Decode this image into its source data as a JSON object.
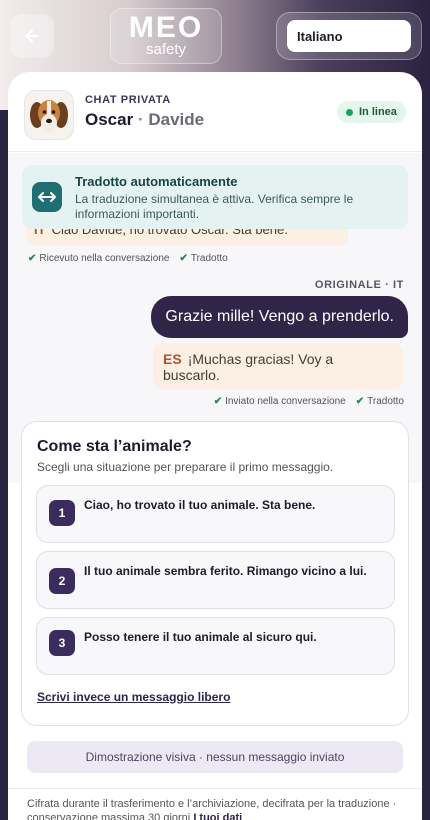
{
  "header": {
    "back_label": "Back",
    "logo_main": "MEO",
    "logo_sub": "safety",
    "language": "Italiano"
  },
  "chat": {
    "kicker": "CHAT PRIVATA",
    "pet_name": "Oscar",
    "separator": "·",
    "owner_name": "Davide",
    "status": "In linea"
  },
  "banner": {
    "title": "Tradotto automaticamente",
    "body": "La traduzione simultanea è attiva. Verifica sempre le informazioni importanti."
  },
  "messages": {
    "previous": {
      "lang": "IT",
      "text": "Ciao Davide, ho trovato Oscar. Sta bene.",
      "status_received": "Ricevuto nella conversazione",
      "status_translated": "Tradotto"
    },
    "outgoing": {
      "original_label": "ORIGINALE · IT",
      "text": "Grazie mille! Vengo a prenderlo.",
      "translation_lang": "ES",
      "translation": "¡Muchas gracias! Voy a buscarlo.",
      "status_sent": "Inviato nella conversazione",
      "status_translated": "Tradotto"
    }
  },
  "situations": {
    "title": "Come sta l’animale?",
    "subtitle": "Scegli una situazione per preparare il primo messaggio.",
    "options": [
      {
        "num": "1",
        "text": "Ciao, ho trovato il tuo animale. Sta bene."
      },
      {
        "num": "2",
        "text": "Il tuo animale sembra ferito. Rimango vicino a lui."
      },
      {
        "num": "3",
        "text": "Posso tenere il tuo animale al sicuro qui."
      }
    ],
    "free_link": "Scrivi invece un messaggio libero"
  },
  "demo_note": "Dimostrazione visiva · nessun messaggio inviato",
  "footer": {
    "text": "Cifrata durante il trasferimento e l’archiviazione, decifrata per la traduzione · conservazione massima 30 giorni",
    "link": "I tuoi dati"
  },
  "colors": {
    "accent": "#2f2548",
    "online": "#18a35a",
    "banner_bg": "#e4f3f1",
    "translation_bg": "#fcefe3"
  },
  "icons": [
    "arrow-left-icon",
    "dog-avatar-icon",
    "swap-arrows-icon",
    "check-icon"
  ]
}
